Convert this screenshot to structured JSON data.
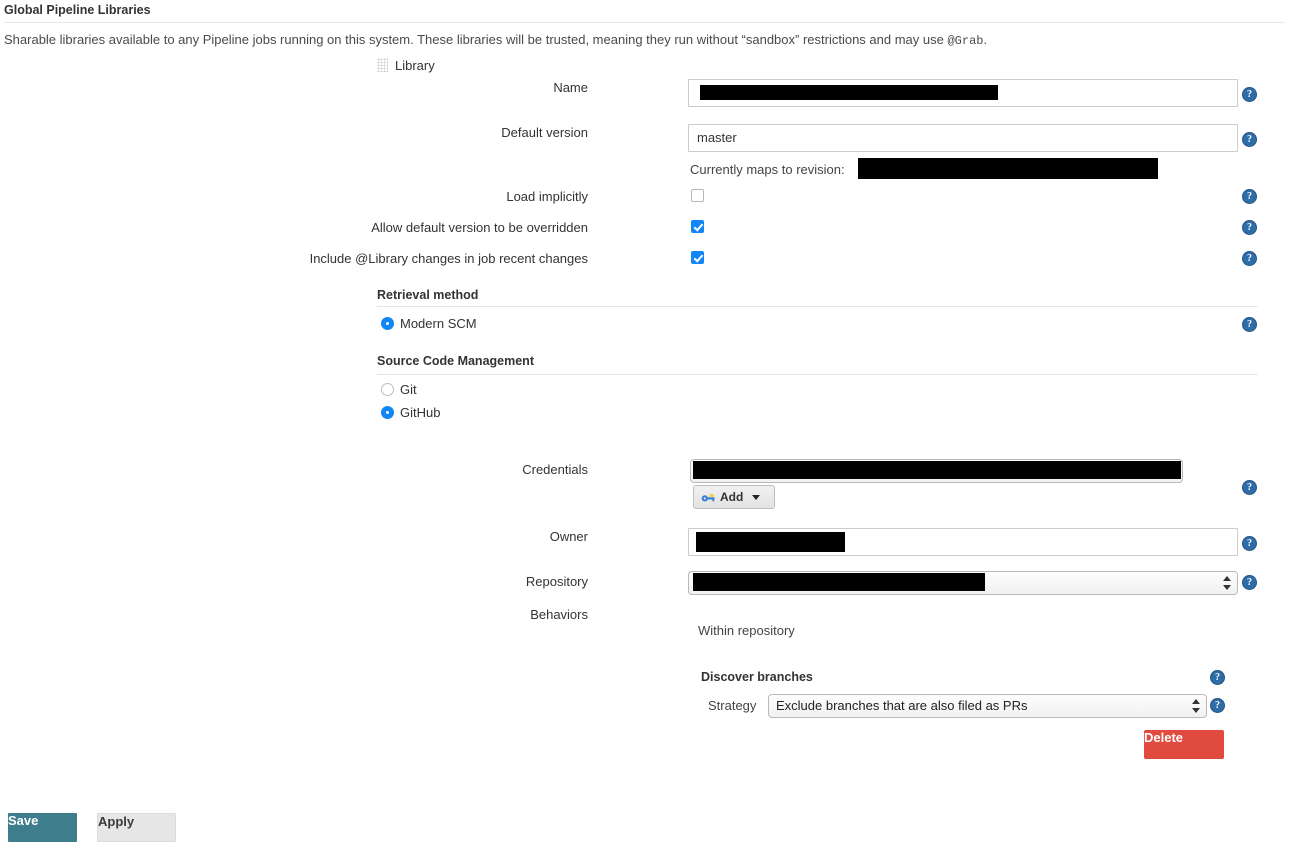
{
  "header": {
    "title": "Global Pipeline Libraries",
    "description_before": "Sharable libraries available to any Pipeline jobs running on this system. These libraries will be trusted, meaning they run without “sandbox” restrictions and may use ",
    "description_code": "@Grab",
    "description_after": "."
  },
  "library": {
    "group_label": "Library",
    "fields": {
      "name_label": "Name",
      "name_value": "",
      "default_version_label": "Default version",
      "default_version_value": "master",
      "currently_maps_label": "Currently maps to revision:",
      "currently_maps_value": "",
      "load_implicitly_label": "Load implicitly",
      "load_implicitly_checked": false,
      "allow_override_label": "Allow default version to be overridden",
      "allow_override_checked": true,
      "include_changes_label": "Include @Library changes in job recent changes",
      "include_changes_checked": true
    }
  },
  "retrieval": {
    "heading": "Retrieval method",
    "options": [
      {
        "label": "Modern SCM",
        "selected": true
      }
    ]
  },
  "scm": {
    "heading": "Source Code Management",
    "options": [
      {
        "label": "Git",
        "selected": false
      },
      {
        "label": "GitHub",
        "selected": true
      }
    ],
    "credentials_label": "Credentials",
    "credentials_value": "",
    "add_button_label": "Add",
    "add_button_icon": "key-icon",
    "owner_label": "Owner",
    "owner_value": "",
    "repository_label": "Repository",
    "repository_value": ""
  },
  "behaviors": {
    "label": "Behaviors",
    "group_title": "Within repository",
    "items": [
      {
        "title": "Discover branches",
        "strategy_label": "Strategy",
        "strategy_value": "Exclude branches that are also filed as PRs",
        "delete_label": "Delete"
      }
    ]
  },
  "footer": {
    "save_label": "Save",
    "apply_label": "Apply"
  },
  "icons": {
    "help": "?"
  }
}
